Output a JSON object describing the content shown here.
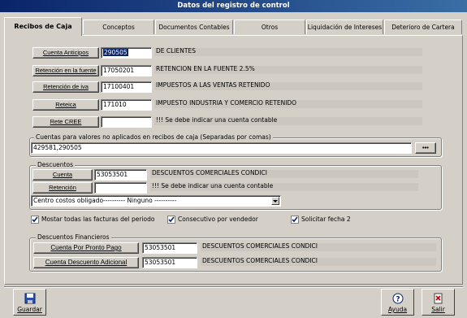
{
  "window": {
    "title": "Datos del registro de control"
  },
  "tabs": [
    {
      "label": "Recibos de Caja",
      "active": true
    },
    {
      "label": "Conceptos"
    },
    {
      "label": "Documentos Contables"
    },
    {
      "label": "Otros"
    },
    {
      "label": "Liquidación de Intereses"
    },
    {
      "label": "Deterioro de Cartera"
    }
  ],
  "cuentas": [
    {
      "button": "Cuenta Anticipos",
      "value": "290505",
      "desc": "DE CLIENTES"
    },
    {
      "button": "Retención en la fuente",
      "value": "17050201",
      "desc": "RETENCION EN LA FUENTE 2.5%"
    },
    {
      "button": "Retención de iva",
      "value": "17100401",
      "desc": "IMPUESTOS A LAS VENTAS RETENIDO"
    },
    {
      "button": "Reteica",
      "value": "171010",
      "desc": "IMPUESTO INDUSTRIA Y COMERCIO RETENIDO"
    },
    {
      "button": "Rete CREE",
      "value": "",
      "desc": "!!! Se debe indicar una cuenta contable"
    }
  ],
  "no_aplicados": {
    "legend": "Cuentas para valores no aplicados en recibos de caja (Separadas por comas)",
    "value": "429581,290505",
    "button": "•••"
  },
  "descuentos": {
    "legend": "Descuentos",
    "cuenta_button": "Cuenta",
    "cuenta_value": "53053501",
    "cuenta_desc": "DESCUENTOS COMERCIALES CONDICI",
    "retencion_button": "Retención",
    "retencion_value": "",
    "retencion_desc": "!!! Se debe indicar una cuenta contable",
    "centro_label": "Centro costos obligado",
    "centro_value": "---------- Ninguno ----------"
  },
  "checks": [
    {
      "label": "Mostar todas las facturas del periodo",
      "checked": true
    },
    {
      "label": "Consecutivo por vendedor",
      "checked": true
    },
    {
      "label": "Solicitar fecha 2",
      "checked": true
    }
  ],
  "financieros": {
    "legend": "Descuentos Financieros",
    "items": [
      {
        "button": "Cuenta Por Pronto Pago",
        "value": "53053501",
        "desc": "DESCUENTOS COMERCIALES CONDICI"
      },
      {
        "button": "Cuenta Descuento Adicional",
        "value": "53053501",
        "desc": "DESCUENTOS COMERCIALES CONDICI"
      }
    ]
  },
  "footer": {
    "guardar": "Guardar",
    "ayuda": "Ayuda",
    "salir": "Salir"
  }
}
